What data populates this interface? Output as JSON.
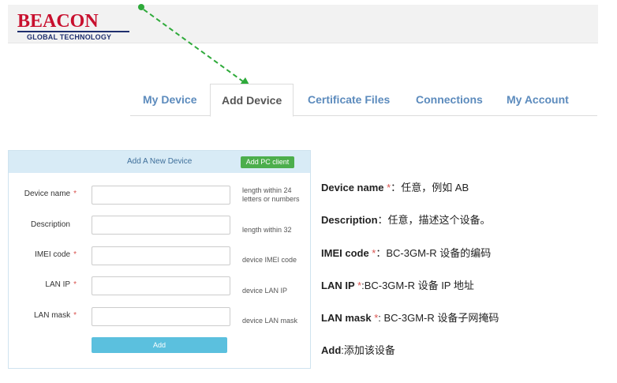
{
  "logo": {
    "name": "BEACON",
    "sub": "GLOBAL TECHNOLOGY"
  },
  "tabs": [
    {
      "label": "My Device",
      "active": false
    },
    {
      "label": "Add Device",
      "active": true
    },
    {
      "label": "Certificate Files",
      "active": false
    },
    {
      "label": "Connections",
      "active": false
    },
    {
      "label": "My Account",
      "active": false
    }
  ],
  "panel": {
    "title": "Add A New Device",
    "pc_client_label": "Add PC client",
    "fields": [
      {
        "label": "Device name",
        "required": true,
        "value": "",
        "hint": "length within 24 letters or numbers"
      },
      {
        "label": "Description",
        "required": false,
        "value": "",
        "hint": "length within 32"
      },
      {
        "label": "IMEI code",
        "required": true,
        "value": "",
        "hint": "device IMEI code"
      },
      {
        "label": "LAN IP",
        "required": true,
        "value": "",
        "hint": "device LAN IP"
      },
      {
        "label": "LAN mask",
        "required": true,
        "value": "",
        "hint": "device LAN mask"
      }
    ],
    "add_label": "Add"
  },
  "notes": [
    {
      "term": "Device name",
      "star": " *",
      "sep": "：",
      "text": "任意，例如 AB"
    },
    {
      "term": "Description",
      "star": "",
      "sep": "：",
      "text": "任意，描述这个设备。"
    },
    {
      "term": "IMEI code ",
      "star": "*",
      "sep": "：",
      "text": "BC-3GM-R 设备的编码"
    },
    {
      "term": "LAN IP ",
      "star": "*",
      "sep": ":",
      "text": "BC-3GM-R 设备 IP 地址"
    },
    {
      "term": "LAN mask ",
      "star": "*",
      "sep": ": ",
      "text": "BC-3GM-R 设备子网掩码"
    },
    {
      "term": "Add",
      "star": "",
      "sep": ":",
      "text": "添加该设备"
    }
  ],
  "colors": {
    "brand_red": "#c8102e",
    "brand_navy": "#1f2f6e",
    "tab_link": "#5c8bbd",
    "arrow": "#2eaa3a",
    "required": "#d9534f",
    "add_button": "#5bc0de",
    "pc_button": "#4cae4c"
  }
}
